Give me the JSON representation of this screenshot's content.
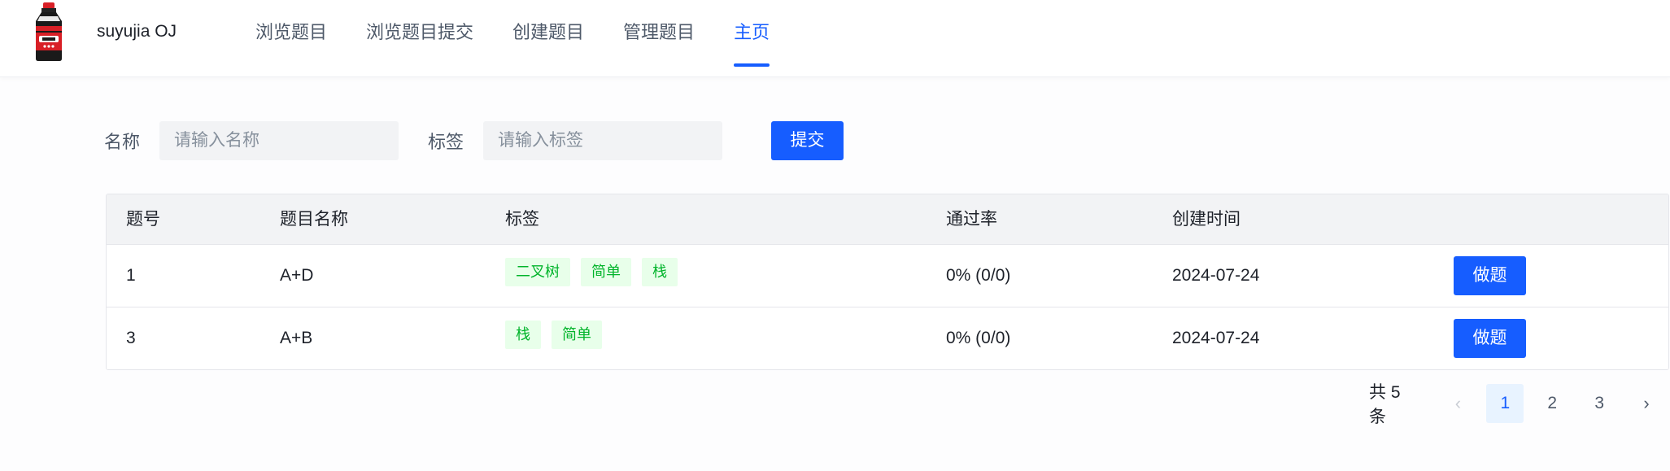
{
  "header": {
    "brand": "suyujia OJ",
    "nav": [
      {
        "label": "浏览题目"
      },
      {
        "label": "浏览题目提交"
      },
      {
        "label": "创建题目"
      },
      {
        "label": "管理题目"
      },
      {
        "label": "主页",
        "active": true
      }
    ]
  },
  "search": {
    "name_label": "名称",
    "name_placeholder": "请输入名称",
    "tag_label": "标签",
    "tag_placeholder": "请输入标签",
    "submit_label": "提交"
  },
  "table": {
    "columns": [
      "题号",
      "题目名称",
      "标签",
      "通过率",
      "创建时间",
      ""
    ],
    "rows": [
      {
        "id": "1",
        "name": "A+D",
        "tags": [
          "二叉树",
          "简单",
          "栈"
        ],
        "pass_rate": "0% (0/0)",
        "created": "2024-07-24",
        "action": "做题"
      },
      {
        "id": "3",
        "name": "A+B",
        "tags": [
          "栈",
          "简单"
        ],
        "pass_rate": "0% (0/0)",
        "created": "2024-07-24",
        "action": "做题"
      }
    ]
  },
  "pagination": {
    "total": "共 5 条",
    "pages": [
      "1",
      "2",
      "3"
    ],
    "current": "1",
    "prev_icon": "chevron-left-icon",
    "next_icon": "chevron-right-icon"
  },
  "colors": {
    "primary": "#165dff",
    "tag_bg": "#e8ffea",
    "tag_text": "#00b42a",
    "table_header_bg": "#f2f3f5"
  }
}
